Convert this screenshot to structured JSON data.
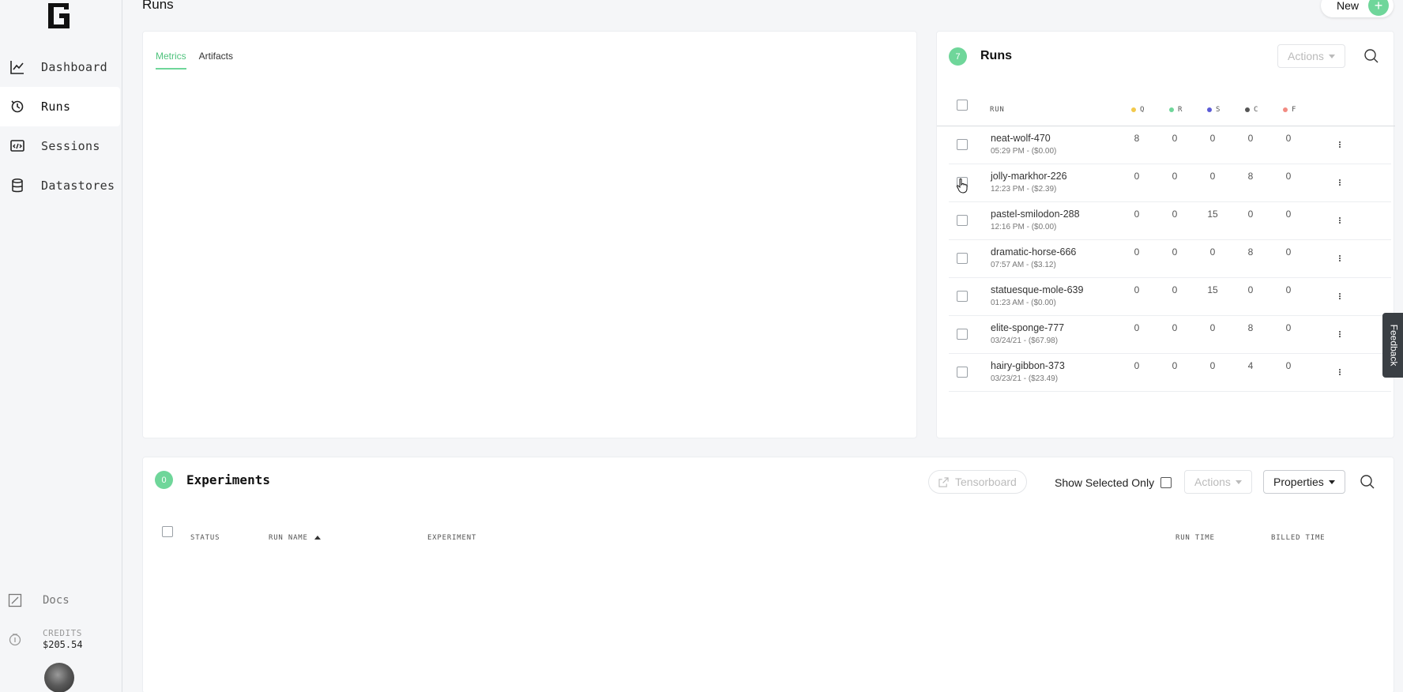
{
  "sidebar": {
    "items": [
      {
        "label": "Dashboard",
        "icon": "chart-line-icon",
        "active": false
      },
      {
        "label": "Runs",
        "icon": "runs-icon",
        "active": true
      },
      {
        "label": "Sessions",
        "icon": "code-window-icon",
        "active": false
      },
      {
        "label": "Datastores",
        "icon": "database-icon",
        "active": false
      }
    ],
    "docs_label": "Docs",
    "credits_label": "CREDITS",
    "credits_amount": "$205.54"
  },
  "header": {
    "title": "Runs",
    "new_label": "New",
    "new_icon": "+"
  },
  "metrics_panel": {
    "tabs": [
      {
        "label": "Metrics",
        "active": true
      },
      {
        "label": "Artifacts",
        "active": false
      }
    ]
  },
  "runs_panel": {
    "count": "7",
    "title": "Runs",
    "actions_label": "Actions",
    "columns": {
      "run": "RUN",
      "q": "Q",
      "r": "R",
      "s": "S",
      "c": "C",
      "f": "F"
    },
    "status_colors": {
      "q": "#f2c94c",
      "r": "#6fd69a",
      "s": "#5b5bd6",
      "c": "#555555",
      "f": "#f28b82"
    },
    "rows": [
      {
        "name": "neat-wolf-470",
        "meta": "05:29 PM - ($0.00)",
        "q": "8",
        "r": "0",
        "s": "0",
        "c": "0",
        "f": "0"
      },
      {
        "name": "jolly-markhor-226",
        "meta": "12:23 PM - ($2.39)",
        "q": "0",
        "r": "0",
        "s": "0",
        "c": "8",
        "f": "0"
      },
      {
        "name": "pastel-smilodon-288",
        "meta": "12:16 PM - ($0.00)",
        "q": "0",
        "r": "0",
        "s": "15",
        "c": "0",
        "f": "0"
      },
      {
        "name": "dramatic-horse-666",
        "meta": "07:57 AM - ($3.12)",
        "q": "0",
        "r": "0",
        "s": "0",
        "c": "8",
        "f": "0"
      },
      {
        "name": "statuesque-mole-639",
        "meta": "01:23 AM - ($0.00)",
        "q": "0",
        "r": "0",
        "s": "15",
        "c": "0",
        "f": "0"
      },
      {
        "name": "elite-sponge-777",
        "meta": "03/24/21 - ($67.98)",
        "q": "0",
        "r": "0",
        "s": "0",
        "c": "8",
        "f": "0"
      },
      {
        "name": "hairy-gibbon-373",
        "meta": "03/23/21 - ($23.49)",
        "q": "0",
        "r": "0",
        "s": "0",
        "c": "4",
        "f": "0"
      }
    ]
  },
  "experiments_panel": {
    "count": "0",
    "title": "Experiments",
    "tensorboard_label": "Tensorboard",
    "show_selected_label": "Show Selected Only",
    "actions_label": "Actions",
    "properties_label": "Properties",
    "columns": {
      "status": "STATUS",
      "run_name": "RUN NAME",
      "experiment": "EXPERIMENT",
      "run_time": "RUN TIME",
      "billed_time": "BILLED TIME"
    }
  },
  "feedback_label": "Feedback",
  "accent_color": "#6fd69a"
}
